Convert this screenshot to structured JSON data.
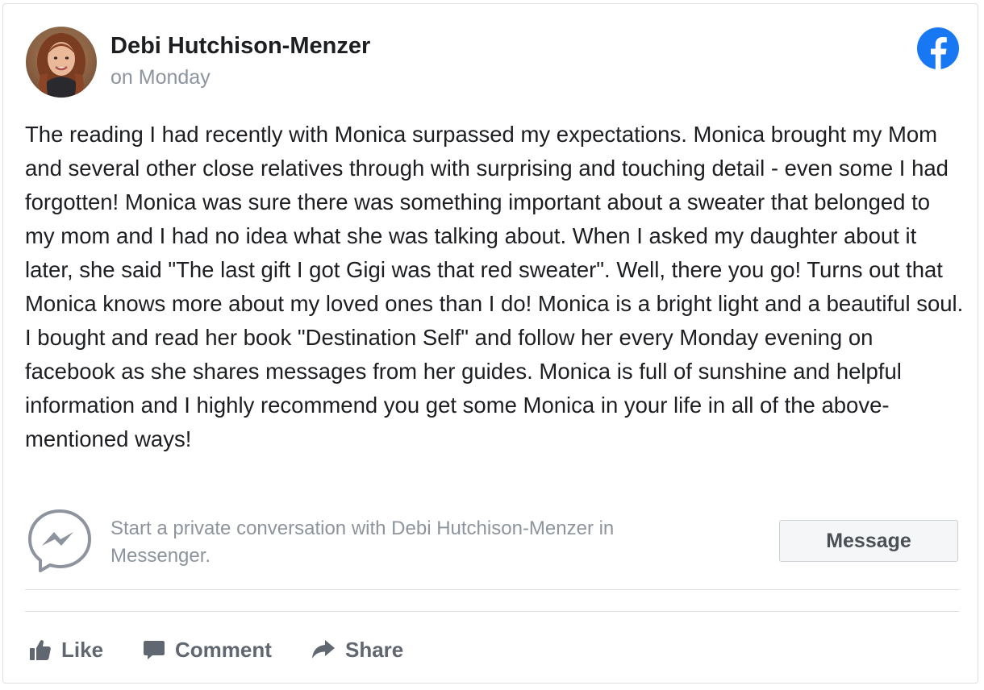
{
  "post": {
    "author": "Debi Hutchison-Menzer",
    "time": "on Monday",
    "text": "The reading I had recently with Monica surpassed my expectations. Monica brought my Mom and several other close relatives through with surprising and touching detail - even some I had forgotten! Monica was sure there was something important about a sweater that belonged to my mom and I had no idea what she was talking about. When I asked my daughter about it later, she said \"The last gift I got Gigi was that red sweater\". Well, there you go! Turns out that Monica knows more about my loved ones than I do! Monica is a bright light and a beautiful soul. I bought and read her book \"Destination Self\" and follow her every Monday evening on facebook as she shares messages from her guides. Monica is full of sunshine and helpful information and I highly recommend you get some Monica in your life in all of the above-mentioned ways!"
  },
  "messenger": {
    "prompt": "Start a private conversation with Debi Hutchison-Menzer in Messenger.",
    "button_label": "Message"
  },
  "actions": {
    "like": "Like",
    "comment": "Comment",
    "share": "Share"
  },
  "icons": {
    "brand": "facebook-logo-icon",
    "messenger": "messenger-icon",
    "like": "thumbs-up-icon",
    "comment": "comment-bubble-icon",
    "share": "share-arrow-icon"
  },
  "colors": {
    "facebook_blue": "#1877f2",
    "text": "#1c1e21",
    "muted": "#8d949e",
    "action": "#606770"
  }
}
